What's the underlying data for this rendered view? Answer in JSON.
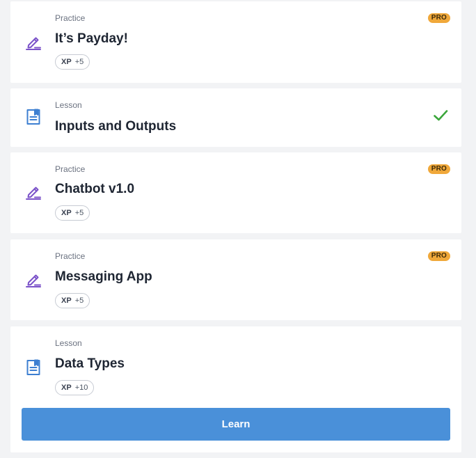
{
  "colors": {
    "practice_icon": "#7b52c9",
    "lesson_icon": "#3d7fd1",
    "pro_badge": "#f0a83a",
    "check": "#3aa63a",
    "learn_button": "#4a90d9"
  },
  "items": [
    {
      "kind": "Practice",
      "title": "It’s Payday!",
      "xp_label": "XP",
      "xp_value": "+5",
      "badge": "PRO",
      "icon": "edit-pencil-icon"
    },
    {
      "kind": "Lesson",
      "title": "Inputs and Outputs",
      "icon": "lesson-document-icon",
      "status_icon": "checkmark-icon"
    },
    {
      "kind": "Practice",
      "title": "Chatbot v1.0",
      "xp_label": "XP",
      "xp_value": "+5",
      "badge": "PRO",
      "icon": "edit-pencil-icon"
    },
    {
      "kind": "Practice",
      "title": "Messaging App",
      "xp_label": "XP",
      "xp_value": "+5",
      "badge": "PRO",
      "icon": "edit-pencil-icon"
    },
    {
      "kind": "Lesson",
      "title": "Data Types",
      "xp_label": "XP",
      "xp_value": "+10",
      "icon": "lesson-document-icon",
      "button_label": "Learn"
    }
  ]
}
